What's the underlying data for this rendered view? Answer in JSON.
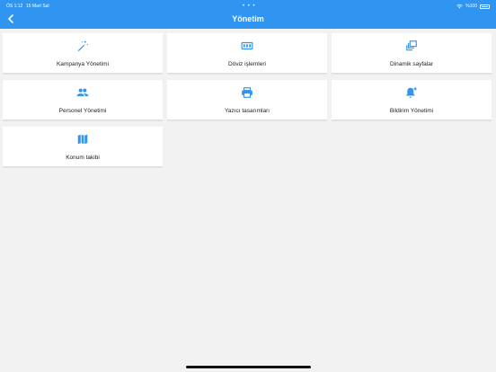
{
  "status_bar": {
    "time": "ÖS 1:12",
    "date": "15 Mart Sal",
    "dots": "• • •",
    "battery": "%100"
  },
  "header": {
    "title": "Yönetim",
    "back_icon": "chevron-left-icon",
    "background_color": "#2f95f0"
  },
  "accent_color": "#2f95f0",
  "menu": [
    {
      "label": "Kampanya Yönetimi",
      "icon": "magic-wand-icon"
    },
    {
      "label": "Döviz işlemleri",
      "icon": "currency-exchange-icon"
    },
    {
      "label": "Dinamik sayfalar",
      "icon": "layers-icon"
    },
    {
      "label": "Personel Yönetimi",
      "icon": "people-icon"
    },
    {
      "label": "Yazıcı tasarımları",
      "icon": "printer-icon"
    },
    {
      "label": "Bildirim Yönetimi",
      "icon": "notification-add-icon"
    },
    {
      "label": "Konum takibi",
      "icon": "map-icon"
    }
  ]
}
